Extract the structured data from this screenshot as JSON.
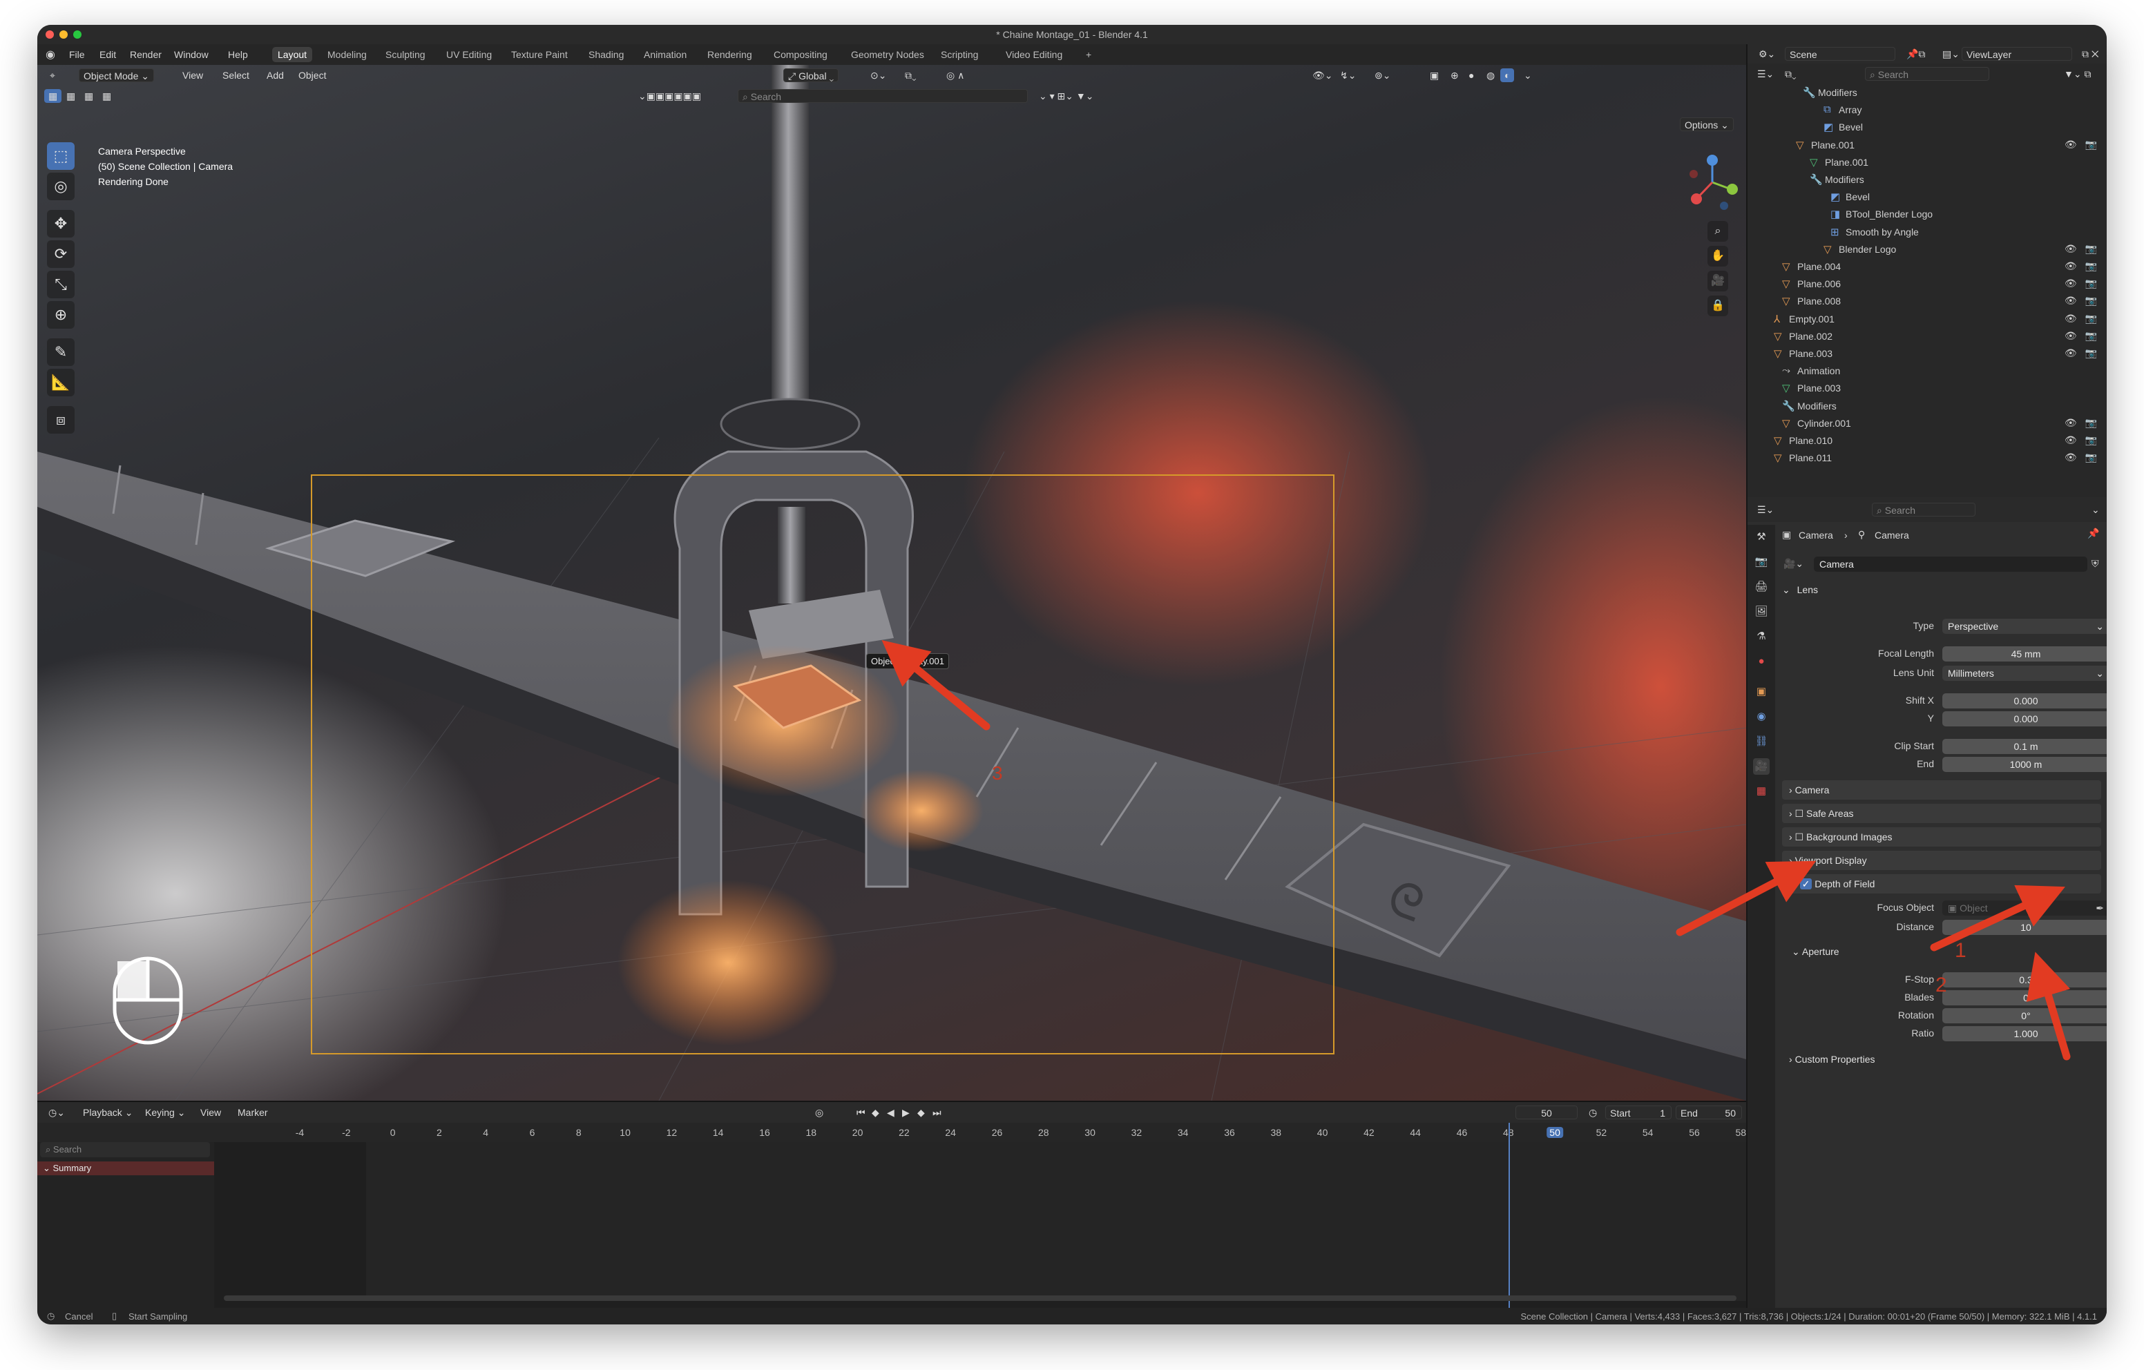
{
  "window": {
    "title": "* Chaine Montage_01 - Blender 4.1"
  },
  "menubar": {
    "menus": [
      "File",
      "Edit",
      "Render",
      "Window",
      "Help"
    ],
    "workspaces": [
      "Layout",
      "Modeling",
      "Sculpting",
      "UV Editing",
      "Texture Paint",
      "Shading",
      "Animation",
      "Rendering",
      "Compositing",
      "Geometry Nodes",
      "Scripting",
      "Video Editing"
    ],
    "active_workspace": "Layout",
    "add_tab": "+",
    "scene_label": "Scene",
    "viewlayer_label": "ViewLayer"
  },
  "viewport": {
    "mode": "Object Mode",
    "menus": [
      "View",
      "Select",
      "Add",
      "Object"
    ],
    "transform_orientation": "Global",
    "search_placeholder": "Search",
    "options_label": "Options",
    "info_line1": "Camera Perspective",
    "info_line2": "(50) Scene Collection | Camera",
    "info_line3": "Rendering Done",
    "tooltip": "Object: Empty.001",
    "annotation_number": "3"
  },
  "outliner": {
    "search_placeholder": "Search",
    "rows": [
      {
        "label": "Modifiers",
        "icon": "wrench-icon",
        "color": "#6f9ee0"
      },
      {
        "label": "Array",
        "icon": "array-icon",
        "color": "#6f9ee0"
      },
      {
        "label": "Bevel",
        "icon": "bevel-icon",
        "color": "#6f9ee0"
      },
      {
        "label": "Plane.001",
        "icon": "mesh-object-icon",
        "color": "#e39a54"
      },
      {
        "label": "Plane.001",
        "icon": "mesh-data-icon",
        "color": "#4fbf77"
      },
      {
        "label": "Modifiers",
        "icon": "wrench-icon",
        "color": "#6f9ee0"
      },
      {
        "label": "Bevel",
        "icon": "bevel-icon",
        "color": "#6f9ee0"
      },
      {
        "label": "BTool_Blender Logo",
        "icon": "boolean-icon",
        "color": "#6f9ee0"
      },
      {
        "label": "Smooth by Angle",
        "icon": "geometry-nodes-icon",
        "color": "#6f9ee0"
      },
      {
        "label": "Blender Logo",
        "icon": "mesh-object-icon",
        "color": "#e39a54"
      },
      {
        "label": "Plane.004",
        "icon": "mesh-object-icon",
        "color": "#e39a54"
      },
      {
        "label": "Plane.006",
        "icon": "mesh-object-icon",
        "color": "#e39a54"
      },
      {
        "label": "Plane.008",
        "icon": "mesh-object-icon",
        "color": "#e39a54"
      },
      {
        "label": "Empty.001",
        "icon": "empty-icon",
        "color": "#e39a54"
      },
      {
        "label": "Plane.002",
        "icon": "mesh-object-icon",
        "color": "#e39a54"
      },
      {
        "label": "Plane.003",
        "icon": "mesh-object-icon",
        "color": "#e39a54"
      },
      {
        "label": "Animation",
        "icon": "animation-icon",
        "color": "#cfcfcf"
      },
      {
        "label": "Plane.003",
        "icon": "mesh-data-icon",
        "color": "#4fbf77"
      },
      {
        "label": "Modifiers",
        "icon": "wrench-icon",
        "color": "#6f9ee0"
      },
      {
        "label": "Cylinder.001",
        "icon": "mesh-object-icon",
        "color": "#e39a54"
      },
      {
        "label": "Plane.010",
        "icon": "mesh-object-icon",
        "color": "#e39a54"
      },
      {
        "label": "Plane.011",
        "icon": "mesh-object-icon",
        "color": "#e39a54"
      }
    ]
  },
  "properties": {
    "search_placeholder": "Search",
    "breadcrumb_object": "Camera",
    "breadcrumb_data": "Camera",
    "datablock_name": "Camera",
    "lens_panel": "Lens",
    "type_label": "Type",
    "type_value": "Perspective",
    "focal_length_label": "Focal Length",
    "focal_length_value": "45 mm",
    "lens_unit_label": "Lens Unit",
    "lens_unit_value": "Millimeters",
    "shift_x_label": "Shift X",
    "shift_x_value": "0.000",
    "shift_y_label": "Y",
    "shift_y_value": "0.000",
    "clip_start_label": "Clip Start",
    "clip_start_value": "0.1 m",
    "clip_end_label": "End",
    "clip_end_value": "1000 m",
    "camera_panel": "Camera",
    "safe_areas_panel": "Safe Areas",
    "background_images_panel": "Background Images",
    "viewport_display_panel": "Viewport Display",
    "dof_panel": "Depth of Field",
    "focus_object_label": "Focus Object",
    "focus_object_placeholder": "Object",
    "distance_label": "Distance",
    "distance_value": "10",
    "aperture_panel": "Aperture",
    "fstop_label": "F-Stop",
    "fstop_value": "0.3",
    "blades_label": "Blades",
    "blades_value": "0",
    "rotation_label": "Rotation",
    "rotation_value": "0°",
    "ratio_label": "Ratio",
    "ratio_value": "1.000",
    "custom_properties_panel": "Custom Properties",
    "annotation_1": "1",
    "annotation_2": "2"
  },
  "timeline": {
    "menus": [
      "Playback",
      "Keying",
      "View",
      "Marker"
    ],
    "current_frame": "50",
    "start_label": "Start",
    "start_value": "1",
    "end_label": "End",
    "end_value": "50",
    "search_placeholder": "Search",
    "summary_label": "Summary",
    "ticks": [
      "-4",
      "-2",
      "0",
      "2",
      "4",
      "6",
      "8",
      "10",
      "12",
      "14",
      "16",
      "18",
      "20",
      "22",
      "24",
      "26",
      "28",
      "30",
      "32",
      "34",
      "36",
      "38",
      "40",
      "42",
      "44",
      "46",
      "48",
      "50",
      "52",
      "54",
      "56",
      "58"
    ],
    "current_tick": "50"
  },
  "statusbar": {
    "cancel_label": "Cancel",
    "start_sampling_label": "Start Sampling",
    "stats": "Scene Collection | Camera | Verts:4,433 | Faces:3,627 | Tris:8,736 | Objects:1/24 | Duration: 00:01+20 (Frame 50/50) | Memory: 322.1 MiB | 4.1.1"
  },
  "colors": {
    "accent_blue": "#4772b3",
    "annotation_red": "#e23b22",
    "camera_frame": "#d69a2a",
    "object_orange": "#e39a54",
    "data_green": "#4fbf77"
  }
}
